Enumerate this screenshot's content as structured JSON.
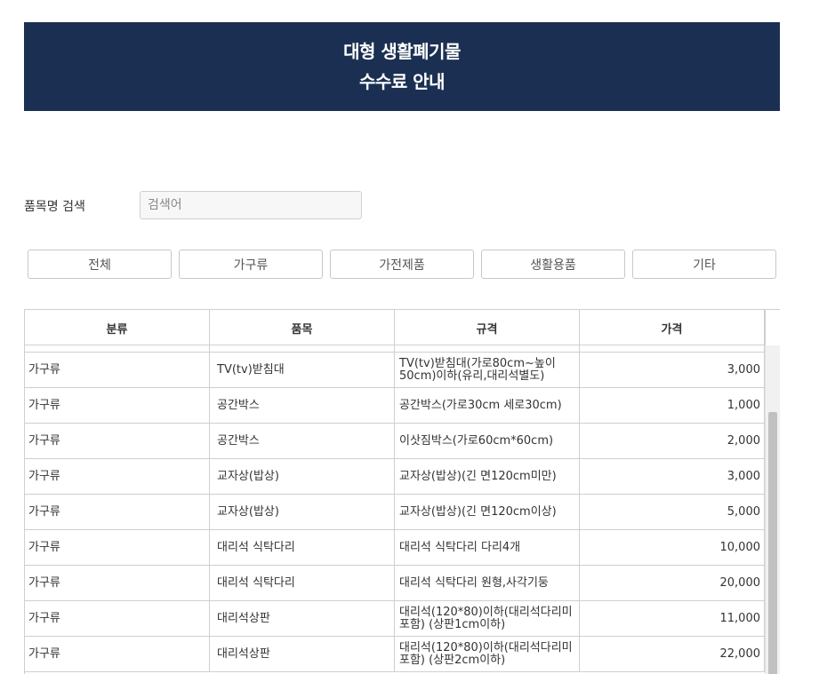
{
  "banner": {
    "title_line1": "대형 생활폐기물",
    "title_line2": "수수료 안내",
    "background": "#1b2f52"
  },
  "search": {
    "label": "품목명 검색",
    "placeholder": "검색어",
    "value": ""
  },
  "categories": [
    "전체",
    "가구류",
    "가전제품",
    "생활용품",
    "기타"
  ],
  "table": {
    "headers": [
      "분류",
      "품목",
      "규격",
      "가격"
    ],
    "rows": [
      {
        "category": "가구류",
        "item": "TV(tv)받침대",
        "spec": "TV(tv)받침대(가로80cm~높이50cm)이하(유리,대리석별도)",
        "price": "3,000"
      },
      {
        "category": "가구류",
        "item": "공간박스",
        "spec": "공간박스(가로30cm 세로30cm)",
        "price": "1,000"
      },
      {
        "category": "가구류",
        "item": "공간박스",
        "spec": "이삿짐박스(가로60cm*60cm)",
        "price": "2,000"
      },
      {
        "category": "가구류",
        "item": "교자상(밥상)",
        "spec": "교자상(밥상)(긴 면120cm미만)",
        "price": "3,000"
      },
      {
        "category": "가구류",
        "item": "교자상(밥상)",
        "spec": "교자상(밥상)(긴 면120cm이상)",
        "price": "5,000"
      },
      {
        "category": "가구류",
        "item": "대리석 식탁다리",
        "spec": "대리석 식탁다리 다리4개",
        "price": "10,000"
      },
      {
        "category": "가구류",
        "item": "대리석 식탁다리",
        "spec": "대리석 식탁다리 원형,사각기둥",
        "price": "20,000"
      },
      {
        "category": "가구류",
        "item": "대리석상판",
        "spec": "대리석(120*80)이하(대리석다리미포함) (상판1cm이하)",
        "price": "11,000"
      },
      {
        "category": "가구류",
        "item": "대리석상판",
        "spec": "대리석(120*80)이하(대리석다리미포함) (상판2cm이하)",
        "price": "22,000"
      }
    ]
  }
}
